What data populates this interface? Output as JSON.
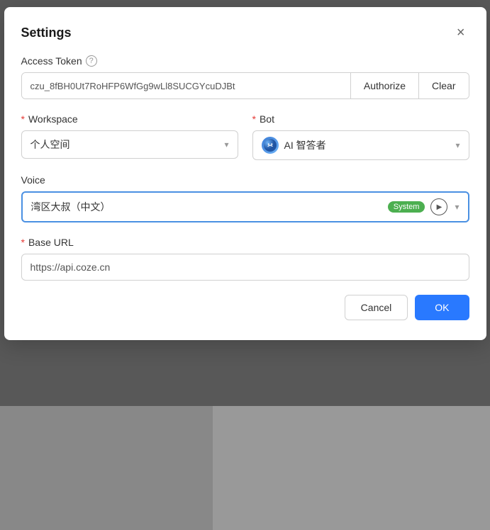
{
  "dialog": {
    "title": "Settings",
    "close_label": "×"
  },
  "access_token": {
    "label": "Access Token",
    "help_icon": "?",
    "value": "czu_8fBH0Ut7RoHFP6WfGg9wLl8SUCGYcuDJBt",
    "authorize_label": "Authorize",
    "clear_label": "Clear"
  },
  "workspace": {
    "label": "Workspace",
    "required": "*",
    "value": "个人空间"
  },
  "bot": {
    "label": "Bot",
    "required": "*",
    "value": "AI 智答者",
    "avatar_text": "A"
  },
  "voice": {
    "label": "Voice",
    "value": "湾区大叔（中文）",
    "badge": "System",
    "play_label": "▶"
  },
  "base_url": {
    "label": "Base URL",
    "required": "*",
    "value": "https://api.coze.cn"
  },
  "footer": {
    "cancel_label": "Cancel",
    "ok_label": "OK"
  }
}
